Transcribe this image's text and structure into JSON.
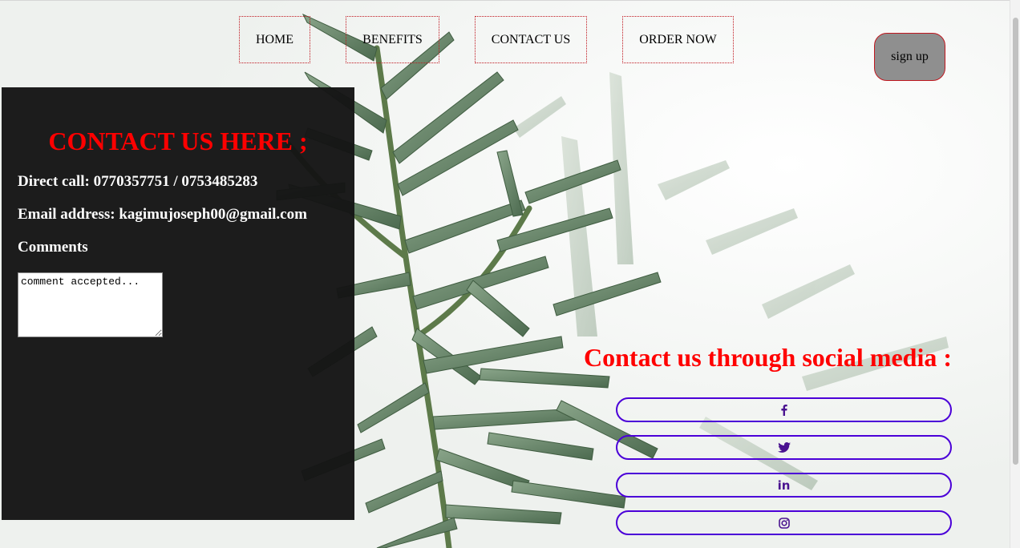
{
  "nav": {
    "items": [
      {
        "label": "HOME"
      },
      {
        "label": "BENEFITS"
      },
      {
        "label": "CONTACT US"
      },
      {
        "label": "ORDER NOW"
      }
    ],
    "signup_label": "sign up"
  },
  "contact": {
    "title": "CONTACT US HERE ;",
    "direct_call": "Direct call: 0770357751 / 0753485283",
    "email": "Email address: kagimujoseph00@gmail.com",
    "comments_label": "Comments",
    "comment_value": "comment accepted..."
  },
  "social": {
    "title": "Contact us through social media :",
    "buttons": [
      {
        "icon": "facebook-icon"
      },
      {
        "icon": "twitter-icon"
      },
      {
        "icon": "linkedin-icon"
      },
      {
        "icon": "instagram-icon"
      }
    ]
  },
  "colors": {
    "accent_red": "#ff0000",
    "panel_bg": "#151515",
    "social_border": "#4b00d8",
    "signup_bg": "#8f8f8f"
  }
}
